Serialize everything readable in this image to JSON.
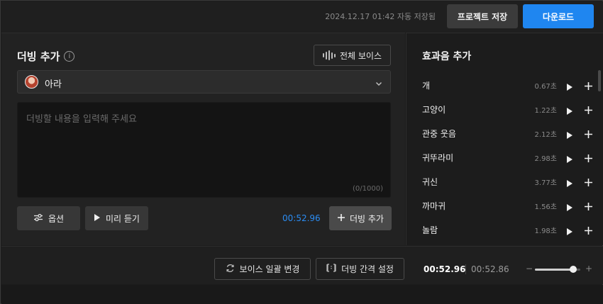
{
  "topbar": {
    "autosave_text": "2024.12.17 01:42 자동 저장됨",
    "save_project_label": "프로젝트 저장",
    "download_label": "다운로드"
  },
  "dub_panel": {
    "title": "더빙 추가",
    "info_icon": "i",
    "all_voice_label": "전체 보이스",
    "voice": {
      "name": "아라"
    },
    "text_input": {
      "placeholder": "더빙할 내용을 입력해 주세요",
      "value": ""
    },
    "char_count": "(0/1000)",
    "options_label": "옵션",
    "preview_label": "미리 듣기",
    "duration": "00:52.96",
    "add_dub_label": "더빙 추가"
  },
  "sfx_panel": {
    "title": "효과음 추가",
    "items": [
      {
        "name": "개",
        "duration": "0.67초"
      },
      {
        "name": "고양이",
        "duration": "1.22초"
      },
      {
        "name": "관중 웃음",
        "duration": "2.12초"
      },
      {
        "name": "귀뚜라미",
        "duration": "2.98초"
      },
      {
        "name": "귀신",
        "duration": "3.77초"
      },
      {
        "name": "까마귀",
        "duration": "1.56초"
      },
      {
        "name": "놀람",
        "duration": "1.98초"
      }
    ]
  },
  "bottom_bar": {
    "batch_voice_label": "보이스 일괄 변경",
    "interval_label": "더빙 간격 설정",
    "time_current": "00:52.96",
    "time_total": "00:52.86",
    "zoom_minus": "−",
    "zoom_plus": "+",
    "zoom_level": 0.85
  },
  "colors": {
    "accent": "#1f86f0",
    "duration_blue": "#2b8cf2"
  },
  "icons": {
    "info": "info-icon",
    "wave": "waveform-icon",
    "chevron": "chevron-down-icon",
    "options": "sliders-icon",
    "play": "play-icon",
    "plus": "plus-icon",
    "refresh": "refresh-icon",
    "interval": "interval-icon"
  }
}
